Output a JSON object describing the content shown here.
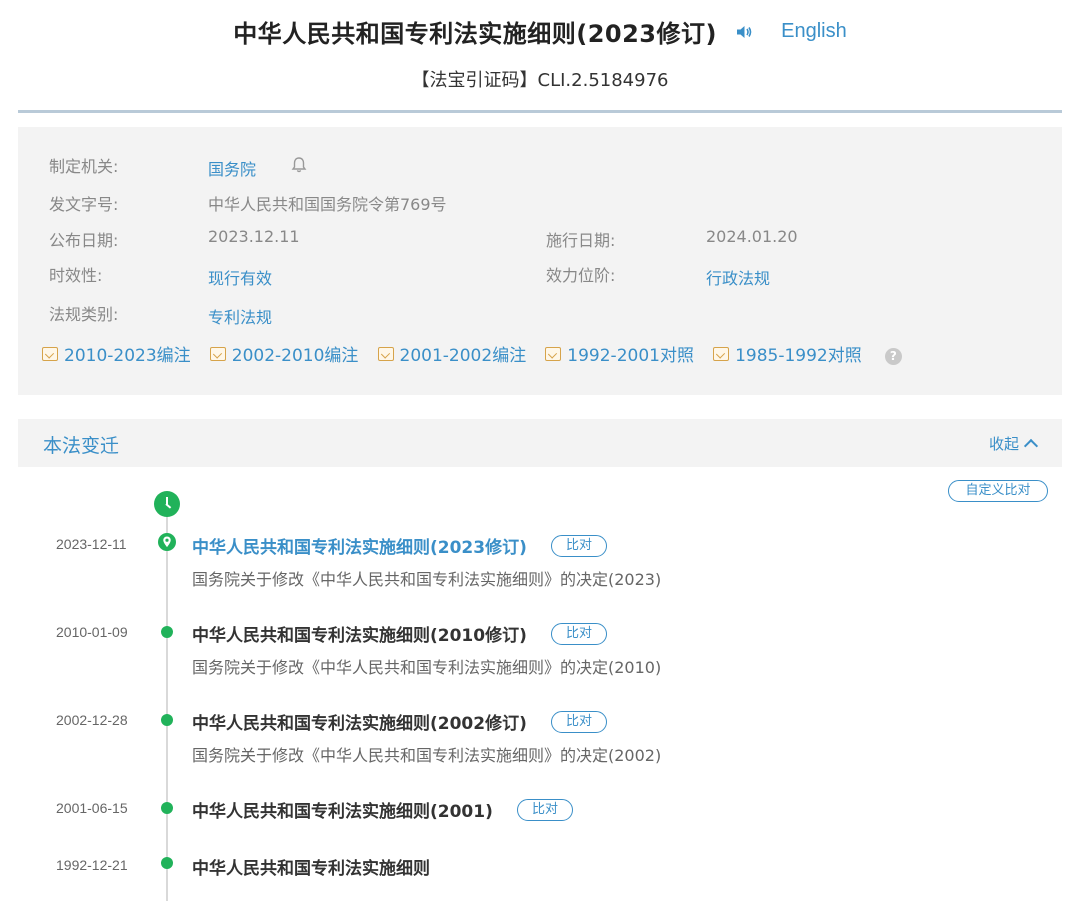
{
  "header": {
    "title": "中华人民共和国专利法实施细则(2023修订)",
    "speaker_icon": "speaker-icon",
    "language_link": "English",
    "citation": "【法宝引证码】CLI.2.5184976"
  },
  "meta": {
    "issuer_label": "制定机关:",
    "issuer_value": "国务院",
    "doc_no_label": "发文字号:",
    "doc_no_value": "中华人民共和国国务院令第769号",
    "publish_label": "公布日期:",
    "publish_value": "2023.12.11",
    "effective_label": "施行日期:",
    "effective_value": "2024.01.20",
    "validity_label": "时效性:",
    "validity_value": "现行有效",
    "level_label": "效力位阶:",
    "level_value": "行政法规",
    "category_label": "法规类别:",
    "category_value": "专利法规",
    "version_links": [
      "2010-2023编注",
      "2002-2010编注",
      "2001-2002编注",
      "1992-2001对照",
      "1985-1992对照"
    ],
    "help_glyph": "?"
  },
  "history": {
    "title": "本法变迁",
    "collapse_label": "收起",
    "custom_compare_label": "自定义比对",
    "items": [
      {
        "date": "2023-12-11",
        "title": "中华人民共和国专利法实施细则(2023修订)",
        "compare": "比对",
        "subtitle": "国务院关于修改《中华人民共和国专利法实施细则》的决定(2023)"
      },
      {
        "date": "2010-01-09",
        "title": "中华人民共和国专利法实施细则(2010修订)",
        "compare": "比对",
        "subtitle": "国务院关于修改《中华人民共和国专利法实施细则》的决定(2010)"
      },
      {
        "date": "2002-12-28",
        "title": "中华人民共和国专利法实施细则(2002修订)",
        "compare": "比对",
        "subtitle": "国务院关于修改《中华人民共和国专利法实施细则》的决定(2002)"
      },
      {
        "date": "2001-06-15",
        "title": "中华人民共和国专利法实施细则(2001)",
        "compare": "比对"
      },
      {
        "date": "1992-12-21",
        "title": "中华人民共和国专利法实施细则"
      }
    ]
  },
  "colors": {
    "link": "#3a8fc8",
    "timeline_green": "#21b25a",
    "panel_bg": "#f3f3f3"
  }
}
